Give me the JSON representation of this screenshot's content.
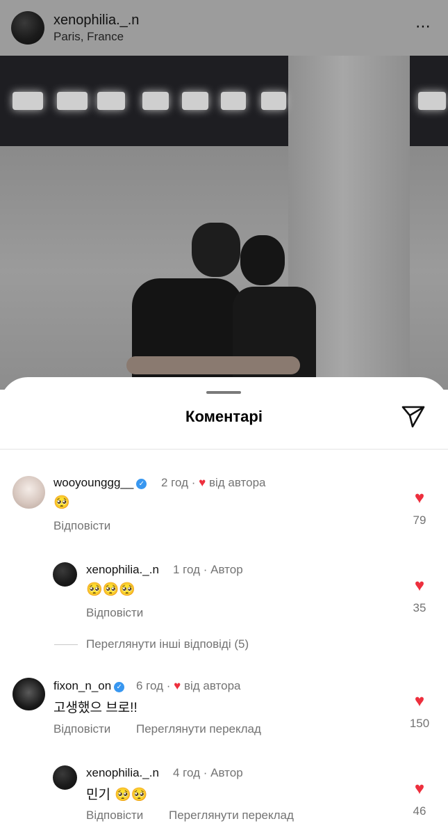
{
  "post": {
    "username": "xenophilia._.n",
    "location": "Paris, France",
    "more_icon": "⋯"
  },
  "sheet": {
    "title": "Коментарі",
    "send_icon": "paper-plane-icon"
  },
  "comments": [
    {
      "username": "wooyounggg__",
      "verified": true,
      "time": "2 год",
      "sep": "·",
      "liked_by_author": "від автора",
      "text": "🥺",
      "reply_label": "Відповісти",
      "likes": "79"
    },
    {
      "username": "xenophilia._.n",
      "time": "1 год",
      "sep": "·",
      "author_label": "Автор",
      "text": "🥺🥺🥺",
      "reply_label": "Відповісти",
      "likes": "35"
    },
    {
      "username": "fixon_n_on",
      "verified": true,
      "time": "6 год",
      "sep": "·",
      "liked_by_author": "від автора",
      "text": "고생했으 브로!!",
      "reply_label": "Відповісти",
      "translate_label": "Переглянути переклад",
      "likes": "150"
    },
    {
      "username": "xenophilia._.n",
      "time": "4 год",
      "sep": "·",
      "author_label": "Автор",
      "text": "민기 🥺🥺",
      "reply_label": "Відповісти",
      "translate_label": "Переглянути переклад",
      "likes": "46"
    }
  ],
  "view_more_replies": "Переглянути інші відповіді (5)",
  "colors": {
    "heart": "#ed2f3d",
    "verified": "#3897f0",
    "meta_gray": "#737373"
  }
}
